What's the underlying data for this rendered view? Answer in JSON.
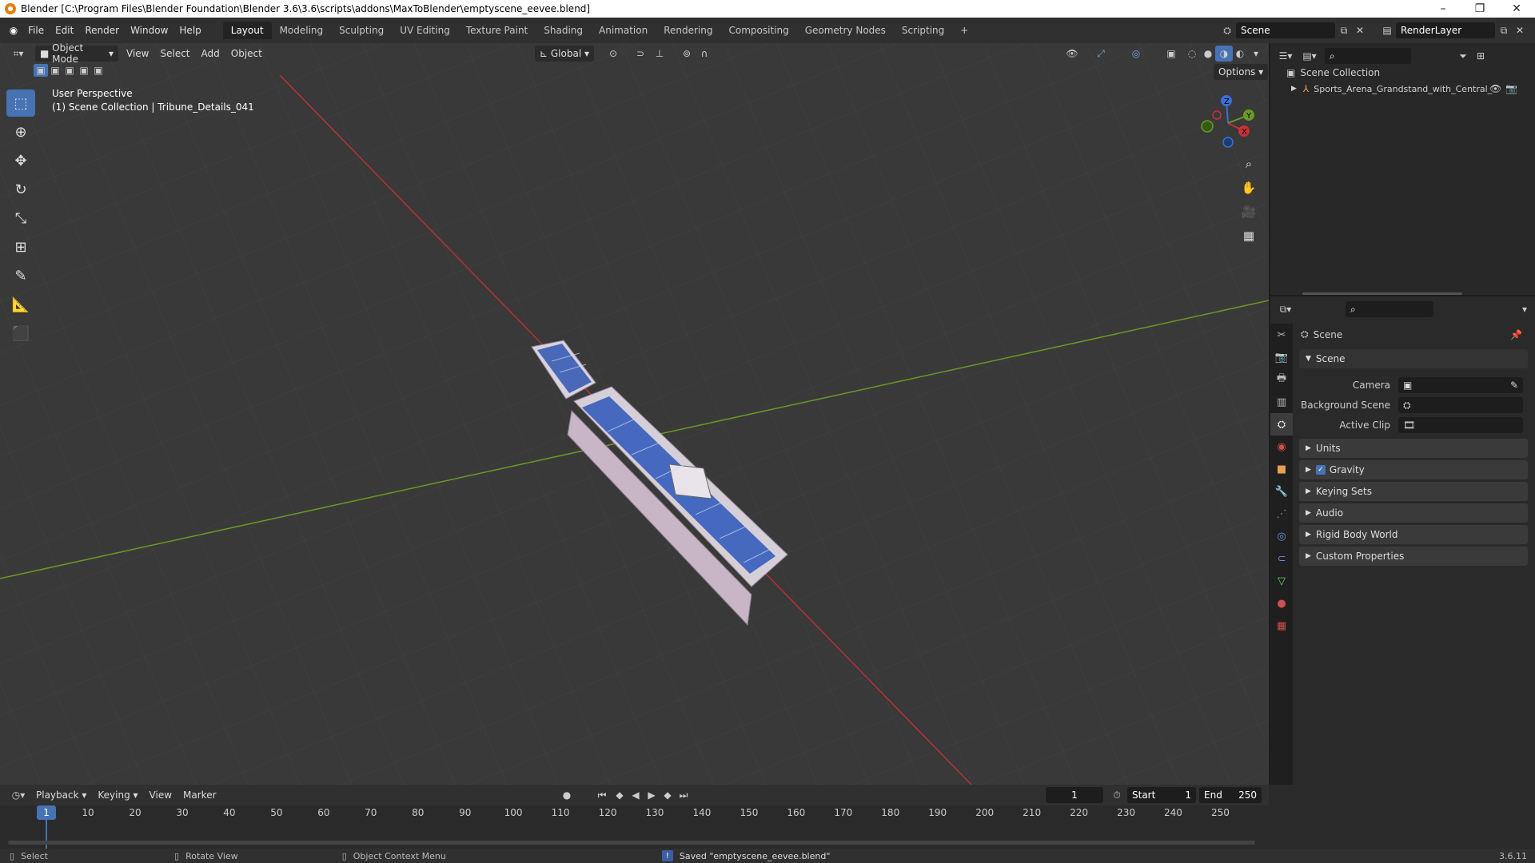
{
  "title": "Blender [C:\\Program Files\\Blender Foundation\\Blender 3.6\\3.6\\scripts\\addons\\MaxToBlender\\emptyscene_eevee.blend]",
  "window_controls": {
    "minimize": "–",
    "maximize": "❐",
    "close": "✕"
  },
  "menu": [
    "File",
    "Edit",
    "Render",
    "Window",
    "Help"
  ],
  "workspaces": [
    "Layout",
    "Modeling",
    "Sculpting",
    "UV Editing",
    "Texture Paint",
    "Shading",
    "Animation",
    "Rendering",
    "Compositing",
    "Geometry Nodes",
    "Scripting",
    "+"
  ],
  "active_workspace": "Layout",
  "scene_name": "Scene",
  "view_layer": "RenderLayer",
  "viewport": {
    "mode": "Object Mode",
    "menus": [
      "View",
      "Select",
      "Add",
      "Object"
    ],
    "transform_orientation": "Global",
    "options_label": "Options",
    "overlay_line1": "User Perspective",
    "overlay_line2": "(1) Scene Collection | Tribune_Details_041",
    "gizmo_axes": [
      "X",
      "Y",
      "Z"
    ],
    "colors": {
      "x_axis": "#c8303a",
      "y_axis": "#6a9a22",
      "z_axis": "#3a6fd8",
      "background": "#393939",
      "grid": "#444444",
      "active_tool": "#4772b3"
    }
  },
  "tools": [
    "select-box",
    "cursor",
    "move",
    "rotate",
    "scale",
    "transform",
    "annotate",
    "measure",
    "add-cube"
  ],
  "outliner": {
    "collection": "Scene Collection",
    "items": [
      {
        "label": "Sports_Arena_Grandstand_with_Central_"
      }
    ]
  },
  "properties": {
    "header": "Scene",
    "section": "Scene",
    "fields": [
      {
        "label": "Camera",
        "value": ""
      },
      {
        "label": "Background Scene",
        "value": ""
      },
      {
        "label": "Active Clip",
        "value": ""
      }
    ],
    "panels": [
      "Units",
      "Gravity",
      "Keying Sets",
      "Audio",
      "Rigid Body World",
      "Custom Properties"
    ],
    "gravity_checked": true
  },
  "timeline": {
    "menus": [
      "Playback",
      "Keying",
      "View",
      "Marker"
    ],
    "current_frame": "1",
    "start_label": "Start",
    "start": "1",
    "end_label": "End",
    "end": "250",
    "ticks": [
      "1",
      "10",
      "20",
      "30",
      "40",
      "50",
      "60",
      "70",
      "80",
      "90",
      "100",
      "110",
      "120",
      "130",
      "140",
      "150",
      "160",
      "170",
      "180",
      "190",
      "200",
      "210",
      "220",
      "230",
      "240",
      "250"
    ]
  },
  "statusbar": {
    "select": "Select",
    "rotate": "Rotate View",
    "context": "Object Context Menu",
    "message": "Saved \"emptyscene_eevee.blend\"",
    "version": "3.6.11"
  }
}
